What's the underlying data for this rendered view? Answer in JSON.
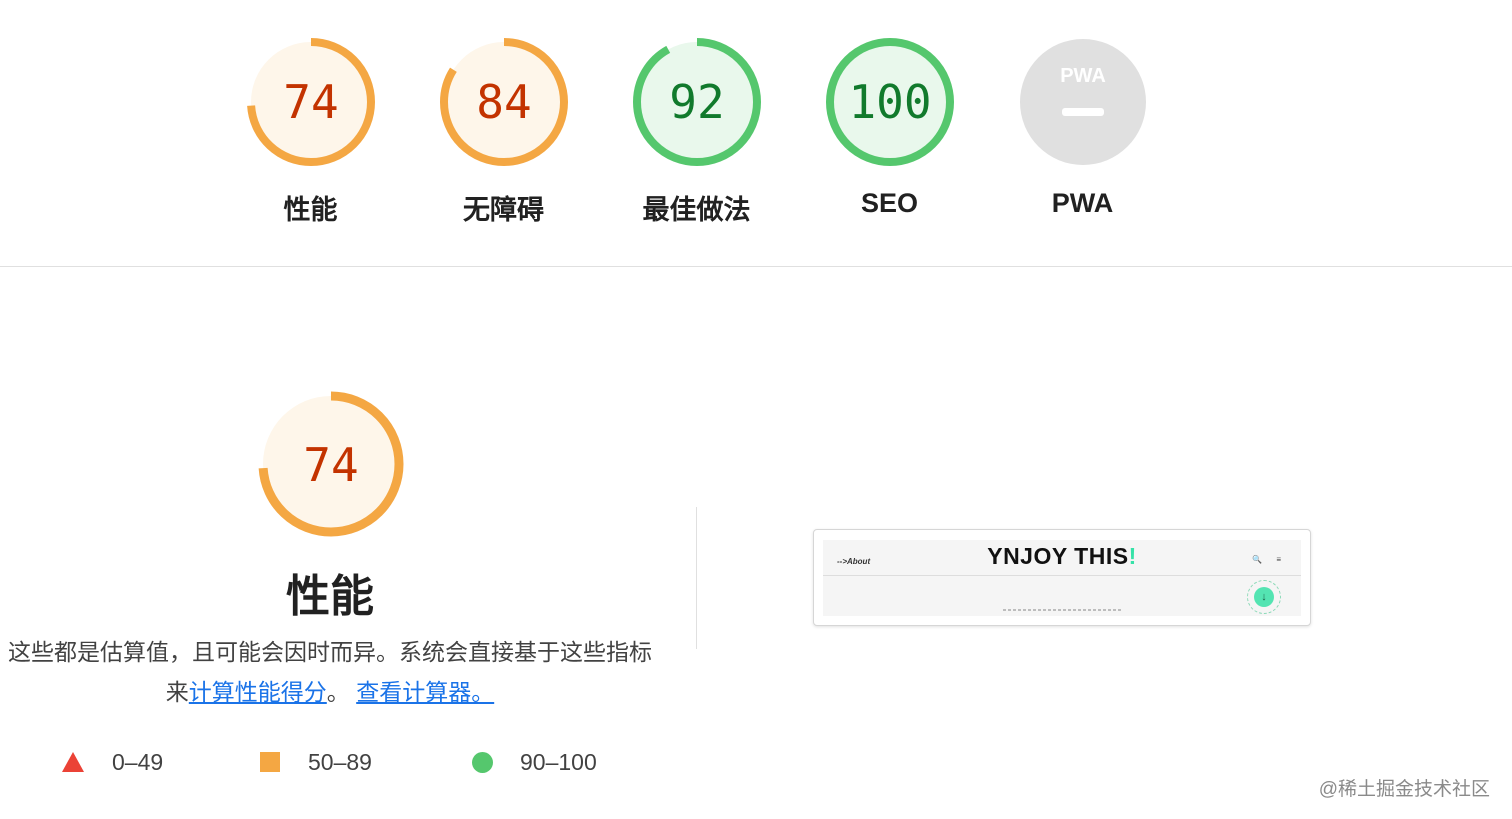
{
  "gauges": [
    {
      "label": "性能",
      "score": "74",
      "value": 74,
      "status": "average"
    },
    {
      "label": "无障碍",
      "score": "84",
      "value": 84,
      "status": "average"
    },
    {
      "label": "最佳做法",
      "score": "92",
      "value": 92,
      "status": "pass"
    },
    {
      "label": "SEO",
      "score": "100",
      "value": 100,
      "status": "pass"
    },
    {
      "label": "PWA",
      "badge_text": "PWA",
      "status": "na"
    }
  ],
  "performance": {
    "score": "74",
    "value": 74,
    "title": "性能",
    "description_before": "这些都是估算值，且可能会因时而异。系统会直接基于这些指标来",
    "calc_link": "计算性能得分",
    "sep": "。",
    "calculator_link": "查看计算器。"
  },
  "legend": {
    "fail": "0–49",
    "average": "50–89",
    "pass": "90–100"
  },
  "screenshot": {
    "nav_text": "-->About",
    "title": "YNJOY THIS",
    "title_accent": "!",
    "icons": "🔍 ≡",
    "badge_icon": "↓"
  },
  "watermark": "@稀土掘金技术社区",
  "colors": {
    "average_stroke": "#f4a743",
    "average_fill": "#fef6ea",
    "average_text": "#c33300",
    "pass_stroke": "#55c76d",
    "pass_fill": "#e9f8ec",
    "pass_text": "#117a2c",
    "na_fill": "#e0e0e0",
    "na_text": "#b3b3b3",
    "fail": "#eb4236",
    "link": "#1a73e8"
  }
}
